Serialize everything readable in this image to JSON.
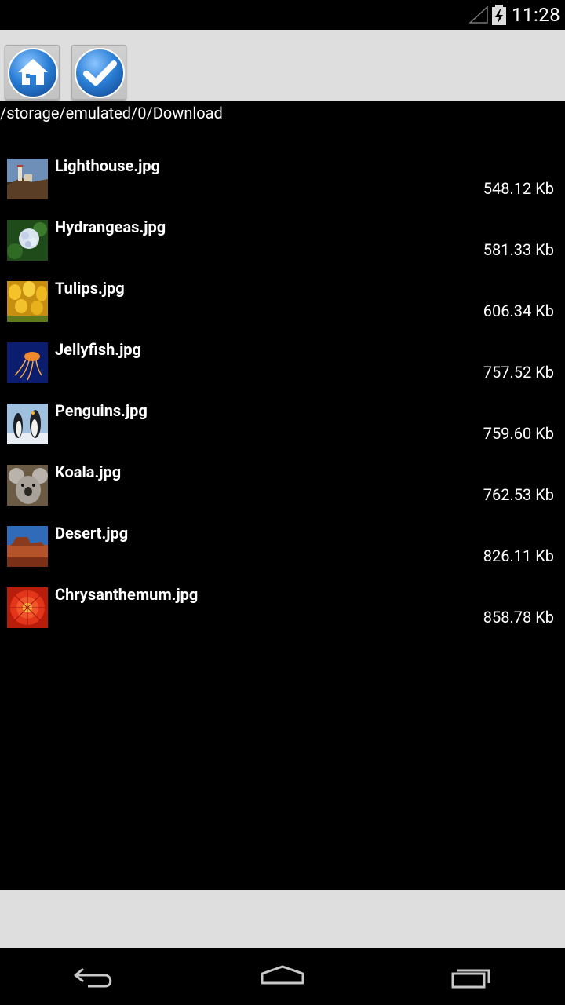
{
  "status_bar": {
    "time": "11:28"
  },
  "toolbar": {
    "home_icon": "home-icon",
    "confirm_icon": "checkmark-icon",
    "accent": "#2a7fd6"
  },
  "path": "/storage/emulated/0/Download",
  "files": [
    {
      "name": "Lighthouse.jpg",
      "size": "548.12 Kb",
      "thumb": "lighthouse-thumbnail"
    },
    {
      "name": "Hydrangeas.jpg",
      "size": "581.33 Kb",
      "thumb": "hydrangeas-thumbnail"
    },
    {
      "name": "Tulips.jpg",
      "size": "606.34 Kb",
      "thumb": "tulips-thumbnail"
    },
    {
      "name": "Jellyfish.jpg",
      "size": "757.52 Kb",
      "thumb": "jellyfish-thumbnail"
    },
    {
      "name": "Penguins.jpg",
      "size": "759.60 Kb",
      "thumb": "penguins-thumbnail"
    },
    {
      "name": "Koala.jpg",
      "size": "762.53 Kb",
      "thumb": "koala-thumbnail"
    },
    {
      "name": "Desert.jpg",
      "size": "826.11 Kb",
      "thumb": "desert-thumbnail"
    },
    {
      "name": "Chrysanthemum.jpg",
      "size": "858.78 Kb",
      "thumb": "chrysanthemum-thumbnail"
    }
  ],
  "nav_bar": {
    "back_icon": "back-icon",
    "home_icon": "home-outline-icon",
    "recent_icon": "recent-apps-icon"
  }
}
